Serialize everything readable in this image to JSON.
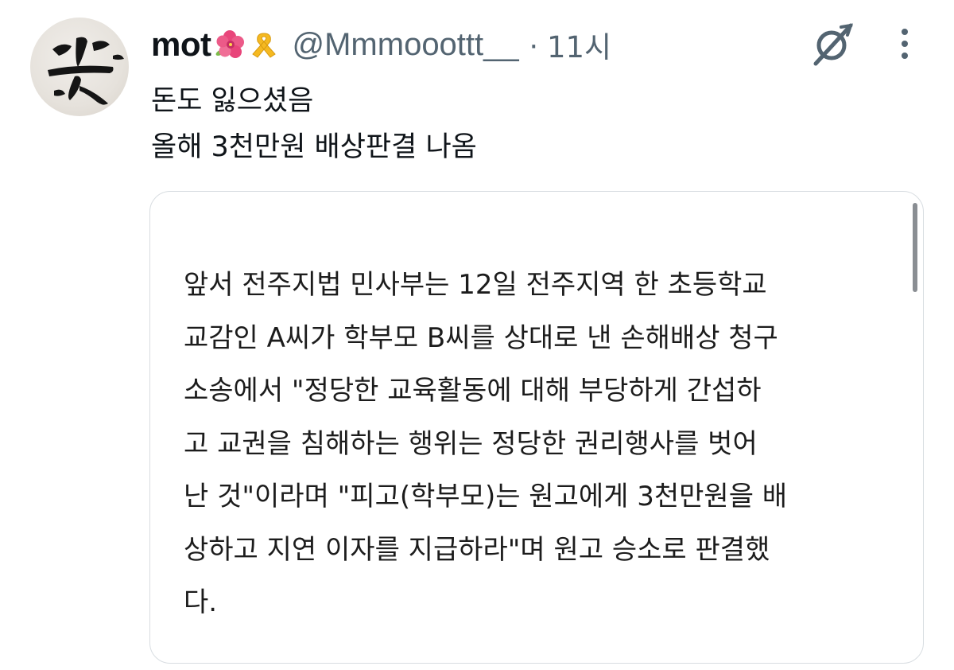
{
  "tweet": {
    "display_name": "mot",
    "emojis": [
      "hibiscus-icon",
      "yellow-ribbon-icon"
    ],
    "handle": "@Mmmooottt__",
    "separator": "·",
    "timestamp": "11시",
    "text_lines": [
      "돈도 잃으셨음",
      "올해 3천만원 배상판결 나옴"
    ],
    "icons": {
      "grok": "grok-icon",
      "more": "more-options-icon"
    }
  },
  "article": {
    "lines": [
      "앞서 전주지법 민사부는 12일 전주지역 한 초등학교",
      "교감인 A씨가 학부모 B씨를 상대로 낸 손해배상 청구",
      "소송에서 \"정당한 교육활동에 대해 부당하게 간섭하",
      "고 교권을 침해하는 행위는 정당한 권리행사를 벗어",
      "난 것\"이라며 \"피고(학부모)는 원고에게 3천만원을 배",
      "상하고 지연 이자를 지급하라\"며 원고 승소로 판결했",
      "다."
    ]
  },
  "colors": {
    "text_primary": "#0f1419",
    "text_secondary": "#536471",
    "card_border": "#d8dde1",
    "article_text": "#1c1c1c"
  }
}
